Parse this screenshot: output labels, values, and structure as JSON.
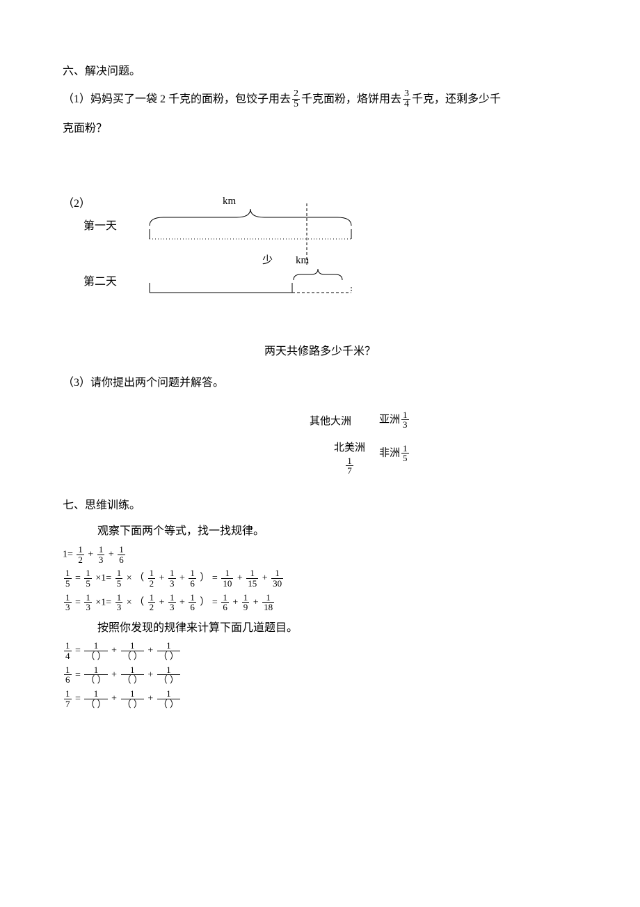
{
  "sec6": {
    "title": "六、解决问题。",
    "q1_pre": "（1）妈妈买了一袋 2 千克的面粉，包饺子用去",
    "q1_f1_num": "2",
    "q1_f1_den": "5",
    "q1_mid": "千克面粉，烙饼用去",
    "q1_f2_num": "3",
    "q1_f2_den": "4",
    "q1_post": "千克，还剩多少千",
    "q1_line2": "克面粉？",
    "q2_num": "（2）",
    "q2_km1": "km",
    "q2_day1": "第一天",
    "q2_shao": "少",
    "q2_km2": "km",
    "q2_day2": "第二天",
    "q2_question": "两天共修路多少千米？",
    "q3": "（3）请你提出两个问题并解答。",
    "pie_other": "其他大洲",
    "pie_asia_label": "亚洲",
    "pie_asia_num": "1",
    "pie_asia_den": "3",
    "pie_na_label": "北美洲",
    "pie_na_num": "1",
    "pie_na_den": "7",
    "pie_africa_label": "非洲",
    "pie_africa_num": "1",
    "pie_africa_den": "5"
  },
  "sec7": {
    "title": "七、思维训练。",
    "intro": "观察下面两个等式，找一找规律。",
    "eq1_lhs": "1=",
    "eq2_lhs_num": "1",
    "eq2_lhs_den": "5",
    "eq3_lhs_num": "1",
    "eq3_lhs_den": "3",
    "half_num": "1",
    "half_den": "2",
    "third_num": "1",
    "third_den": "3",
    "sixth_num": "1",
    "sixth_den": "6",
    "tenth_num": "1",
    "tenth_den": "10",
    "fifteenth_num": "1",
    "fifteenth_den": "15",
    "thirtieth_num": "1",
    "thirtieth_den": "30",
    "sixth2_num": "1",
    "sixth2_den": "6",
    "ninth_num": "1",
    "ninth_den": "9",
    "eighteenth_num": "1",
    "eighteenth_den": "18",
    "rule_text": "按照你发现的规律来计算下面几道题目。",
    "ex1_num": "1",
    "ex1_den": "4",
    "ex2_num": "1",
    "ex2_den": "6",
    "ex3_num": "1",
    "ex3_den": "7",
    "blank_num": "1",
    "blank_den": "（  ）",
    "times1": "×1=",
    "times": "×",
    "lparen": "（",
    "rparen": "）",
    "plus": "+",
    "eq": "="
  }
}
